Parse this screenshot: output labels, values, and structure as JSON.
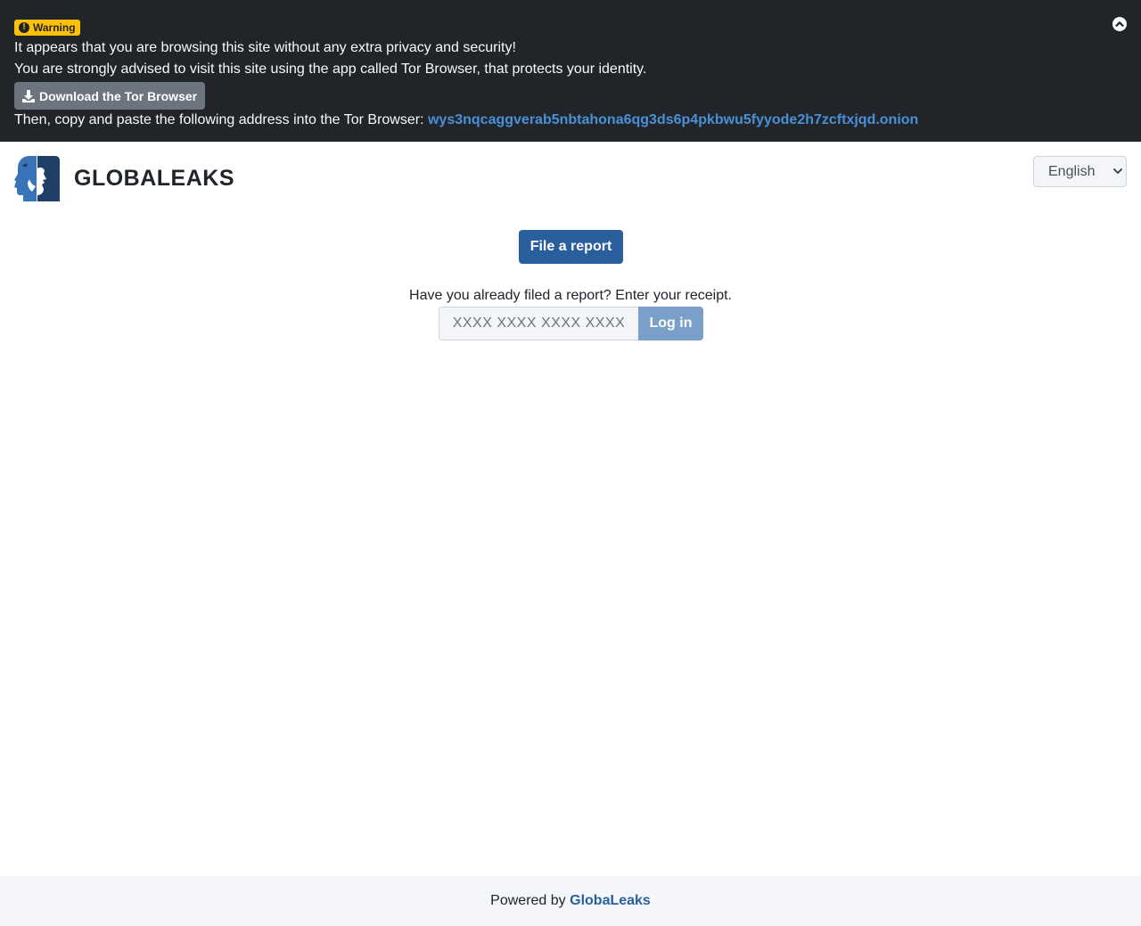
{
  "banner": {
    "badge_label": "Warning",
    "line1": "It appears that you are browsing this site without any extra privacy and security!",
    "line2": "You are strongly advised to visit this site using the app called Tor Browser, that protects your identity.",
    "download_label": "Download the Tor Browser",
    "copy_text": "Then, copy and paste the following address into the Tor Browser:",
    "onion_address": "wys3nqcaggverab5nbtahona6qg3ds6p4pkbwu5fyyode2h7zcftxjqd.onion",
    "icons": {
      "badge": "exclamation-circle-icon",
      "download": "download-icon",
      "collapse": "chevron-up-circle-icon"
    }
  },
  "header": {
    "site_title": "GLOBALEAKS",
    "language": {
      "selected": "English"
    }
  },
  "main": {
    "file_report_label": "File a report",
    "receipt_prompt": "Have you already filed a report? Enter your receipt.",
    "receipt_placeholder": "XXXX XXXX XXXX XXXX",
    "login_label": "Log in"
  },
  "footer": {
    "powered_by": "Powered by",
    "link_label": "GlobaLeaks"
  },
  "colors": {
    "banner_bg": "#212529",
    "badge_bg": "#ffc107",
    "onion_link": "#4a90d6",
    "primary": "#2a5f9e",
    "login_button": "#7a9fc9",
    "footer_bg": "#f4f6f9"
  }
}
